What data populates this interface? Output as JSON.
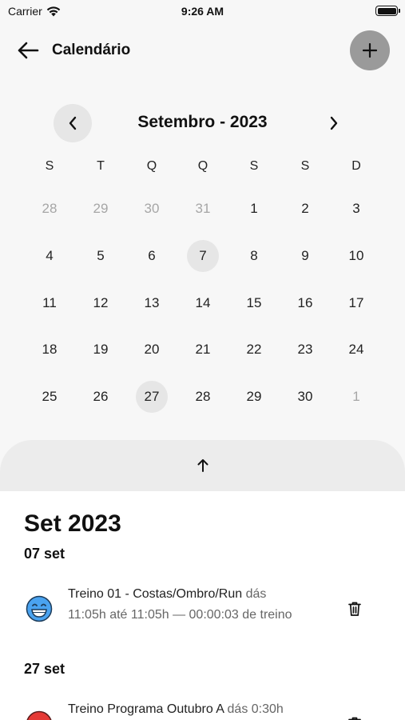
{
  "status_bar": {
    "carrier": "Carrier",
    "time": "9:26 AM"
  },
  "header": {
    "title": "Calendário",
    "back_icon": "arrow-left-icon",
    "add_icon": "plus-icon"
  },
  "calendar": {
    "month_label": "Setembro - 2023",
    "weekdays": [
      "S",
      "T",
      "Q",
      "Q",
      "S",
      "S",
      "D"
    ],
    "days": [
      {
        "label": "28",
        "muted": true
      },
      {
        "label": "29",
        "muted": true
      },
      {
        "label": "30",
        "muted": true
      },
      {
        "label": "31",
        "muted": true
      },
      {
        "label": "1"
      },
      {
        "label": "2"
      },
      {
        "label": "3"
      },
      {
        "label": "4"
      },
      {
        "label": "5"
      },
      {
        "label": "6"
      },
      {
        "label": "7",
        "marked": true
      },
      {
        "label": "8"
      },
      {
        "label": "9"
      },
      {
        "label": "10"
      },
      {
        "label": "11"
      },
      {
        "label": "12"
      },
      {
        "label": "13"
      },
      {
        "label": "14"
      },
      {
        "label": "15"
      },
      {
        "label": "16"
      },
      {
        "label": "17"
      },
      {
        "label": "18"
      },
      {
        "label": "19"
      },
      {
        "label": "20"
      },
      {
        "label": "21"
      },
      {
        "label": "22"
      },
      {
        "label": "23"
      },
      {
        "label": "24"
      },
      {
        "label": "25"
      },
      {
        "label": "26"
      },
      {
        "label": "27",
        "marked": true
      },
      {
        "label": "28"
      },
      {
        "label": "29"
      },
      {
        "label": "30"
      },
      {
        "label": "1",
        "muted": true
      }
    ]
  },
  "sheet": {
    "title": "Set 2023",
    "groups": [
      {
        "date": "07 set",
        "items": [
          {
            "name": "Treino 01 - Costas/Ombro/Run",
            "suffix": "dás",
            "detail": "11:05h até 11:05h — 00:00:03 de treino",
            "emoji": "grinning-face-blue",
            "color": "#4aa3f0"
          }
        ]
      },
      {
        "date": "27 set",
        "items": [
          {
            "name": "Treino Programa Outubro A",
            "suffix": "dás 0:30h",
            "detail": "",
            "emoji": "face-red",
            "color": "#e53935"
          }
        ]
      }
    ]
  },
  "colors": {
    "background": "#f7f7f7",
    "sheet": "#ffffff",
    "marked_day": "#e6e6e6",
    "add_button": "#9a9a9a"
  }
}
